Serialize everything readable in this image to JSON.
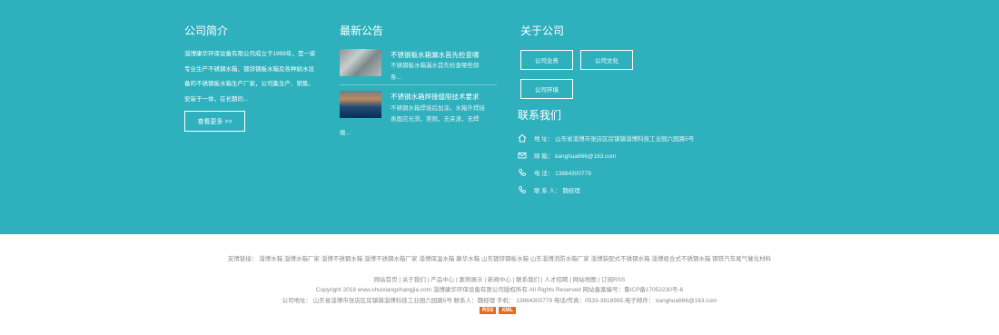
{
  "intro": {
    "heading": "公司简介",
    "text": "淄博康华环保设备有限公司成立于1999年，是一家专业生产不锈钢水箱、镀锌钢板水箱及各种給水设备的不锈钢板水箱生产厂家，公司集生产、销售、安装于一体，在长期的...",
    "button": "查看更多 >>"
  },
  "news": {
    "heading": "最新公告",
    "items": [
      {
        "title": "不锈钢板水箱漏水首先检查哪",
        "desc1": "不锈钢板水箱漏水首先检查哪些部",
        "desc2": "条..."
      },
      {
        "title": "不锈钢水箱焊接缝隙技术要求",
        "desc1": "不锈钢水箱焊接后加涂。水箱外焊接",
        "desc2": "表面应光滑，美观，无夹渣，无焊",
        "desc3": "瘤..."
      }
    ]
  },
  "about": {
    "heading": "关于公司",
    "buttons": [
      "公司业务",
      "公司文化",
      "公司环境"
    ]
  },
  "contact": {
    "heading": "联系我们",
    "address": "地 址： 山东省淄博市张店区房镇镇淄博科技工业园六园路5号",
    "email": "邮 箱： kanghua666@163.com",
    "phone": "电 话： 13864300779",
    "person": "联 系 人： 魏经理"
  },
  "footer": {
    "links": "友情链接：  淄博水箱   淄博水箱厂家   淄博不锈钢水箱   淄博不锈钢水箱厂家   淄博保温水箱   康华水箱   山东镀锌钢板水箱   山东淄博消防水箱厂家   淄博装配式不锈钢水箱   淄博组合式不锈钢水箱   钢铁汽车尾气催化材料",
    "nav": "网站首页 | 关于我们 | 产品中心 | 案例展示 | 新闻中心 | 联系我们 | 人才招聘 | 网站地图 | 订阅RSS",
    "copyright": "Copyright 2018 www.shuixiangchangjia.com  淄博康华环保设备有限公司版权所有    All Rights Reserved  网站备案编号：鲁ICP备17052230号-6",
    "address": "公司地址：  山东省淄博市张店区房镇镇淄博科技工业园六园路5号  联系人：魏经理  手机：  13864300779  电话/传真：0533-3818995,电子邮件：  kanghua666@163.com",
    "badge_rss": "RSS",
    "badge_xml": "XML"
  }
}
